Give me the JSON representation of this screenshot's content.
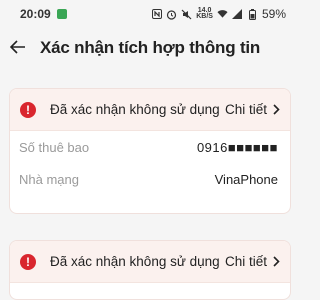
{
  "status_bar": {
    "time": "20:09",
    "speed_top": "14.0",
    "speed_bottom": "KB/S",
    "battery": "59%",
    "notif_color": "#3aa655",
    "icons": [
      "n-icon",
      "alarm-icon",
      "mute-icon",
      "wifi-icon",
      "signal-icon",
      "battery-icon"
    ]
  },
  "app_bar": {
    "back_icon": "back-arrow-icon",
    "title": "Xác nhận tích hợp thông tin"
  },
  "cards": [
    {
      "status": "Đã xác nhận không sử dụng",
      "detail": "Chi tiết",
      "rows": [
        {
          "label": "Số thuê bao",
          "value": "0916■■■■■■"
        },
        {
          "label": "Nhà mạng",
          "value": "VinaPhone"
        }
      ]
    },
    {
      "status": "Đã xác nhận không sử dụng",
      "detail": "Chi tiết"
    }
  ],
  "colors": {
    "error_red": "#d9262e",
    "card_head_bg": "#fbf1ee",
    "label_gray": "#9a9a9a"
  }
}
